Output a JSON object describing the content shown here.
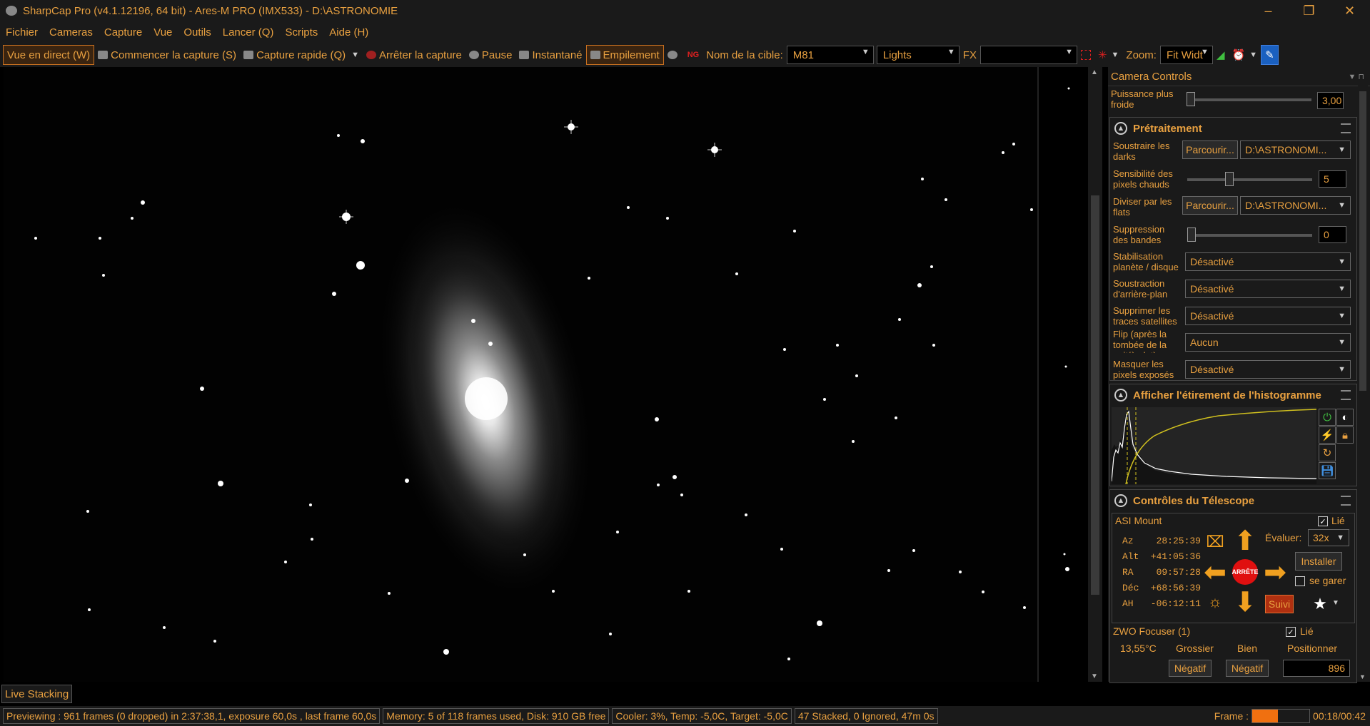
{
  "window": {
    "title": "SharpCap Pro (v4.1.12196, 64 bit) - Ares-M PRO (IMX533) - D:\\ASTRONOMIE",
    "minimize": "–",
    "maximize": "❐",
    "close": "✕"
  },
  "menu": [
    "Fichier",
    "Cameras",
    "Capture",
    "Vue",
    "Outils",
    "Lancer (Q)",
    "Scripts",
    "Aide (H)"
  ],
  "toolbar": {
    "live_view": "Vue en direct (W)",
    "start_capture": "Commencer la capture (S)",
    "quick_capture": "Capture rapide (Q)",
    "stop_capture": "Arrêter la capture",
    "pause": "Pause",
    "snapshot": "Instantané",
    "stacking": "Empilement",
    "target_label": "Nom de la cible:",
    "target_value": "M81",
    "frame_type": "Lights",
    "fx_label": "FX",
    "fx_value": "",
    "zoom_label": "Zoom:",
    "zoom_value": "Fit Widt"
  },
  "panel": {
    "title": "Camera Controls",
    "cooler_power": {
      "label": "Puissance plus froide",
      "value": "3,00"
    },
    "pretraitement": {
      "title": "Prétraitement",
      "darks": {
        "label": "Soustraire les darks",
        "browse": "Parcourir...",
        "path": "D:\\ASTRONOMI..."
      },
      "hot_pixels": {
        "label": "Sensibilité des pixels chauds",
        "value": "5",
        "level": 0.2
      },
      "flats": {
        "label": "Diviser par les flats",
        "browse": "Parcourir...",
        "path": "D:\\ASTRONOMI..."
      },
      "banding": {
        "label": "Suppression des bandes",
        "value": "0",
        "level": 0
      },
      "stabilisation": {
        "label": "Stabilisation planète / disque",
        "value": "Désactivé"
      },
      "background": {
        "label": "Soustraction d'arrière-plan",
        "value": "Désactivé"
      },
      "satellite": {
        "label": "Supprimer les traces satellites",
        "value": "Désactivé"
      },
      "flip": {
        "label": "Flip (après la tombée de la nuit/à plat)",
        "value": "Aucun"
      },
      "mask": {
        "label": "Masquer les pixels exposés",
        "value": "Désactivé"
      }
    },
    "histogram": {
      "title": "Afficher l'étirement de l'histogramme"
    },
    "telescope": {
      "title": "Contrôles du Télescope",
      "mount": "ASI Mount",
      "linked": "Lié",
      "rate_label": "Évaluer:",
      "rate_value": "32x",
      "install": "Installer",
      "park": "se garer",
      "stop": "ARRÊTE",
      "track": "Suivi",
      "coords": [
        {
          "k": "Az",
          "v": "28:25:39"
        },
        {
          "k": "Alt",
          "v": "+41:05:36"
        },
        {
          "k": "RA",
          "v": "09:57:28"
        },
        {
          "k": "Déc",
          "v": "+68:56:39"
        },
        {
          "k": "AH",
          "v": "-06:12:11"
        }
      ]
    },
    "focuser": {
      "name": "ZWO Focuser (1)",
      "linked": "Lié",
      "temp": "13,55°C",
      "coarse": "Grossier",
      "fine": "Bien",
      "position": "Positionner",
      "neg1": "Négatif",
      "neg2": "Négatif",
      "pos_value": "896"
    }
  },
  "live_stacking": "Live Stacking",
  "status": {
    "preview": "Previewing : 961 frames (0 dropped) in 2:37:38,1, exposure 60,0s , last frame 60,0s",
    "memory": "Memory: 5 of 118 frames used, Disk: 910 GB free",
    "cooler": "Cooler: 3%, Temp: -5,0C, Target: -5,0C",
    "stacked": "47 Stacked, 0 Ignored, 47m 0s",
    "frame_label": "Frame :",
    "frame_progress": 0.45,
    "time": "00:18/00:42"
  },
  "colors": {
    "accent": "#e8a040",
    "bg": "#1a1a1a",
    "arrow": "#f0a020",
    "stop": "#e01010"
  }
}
